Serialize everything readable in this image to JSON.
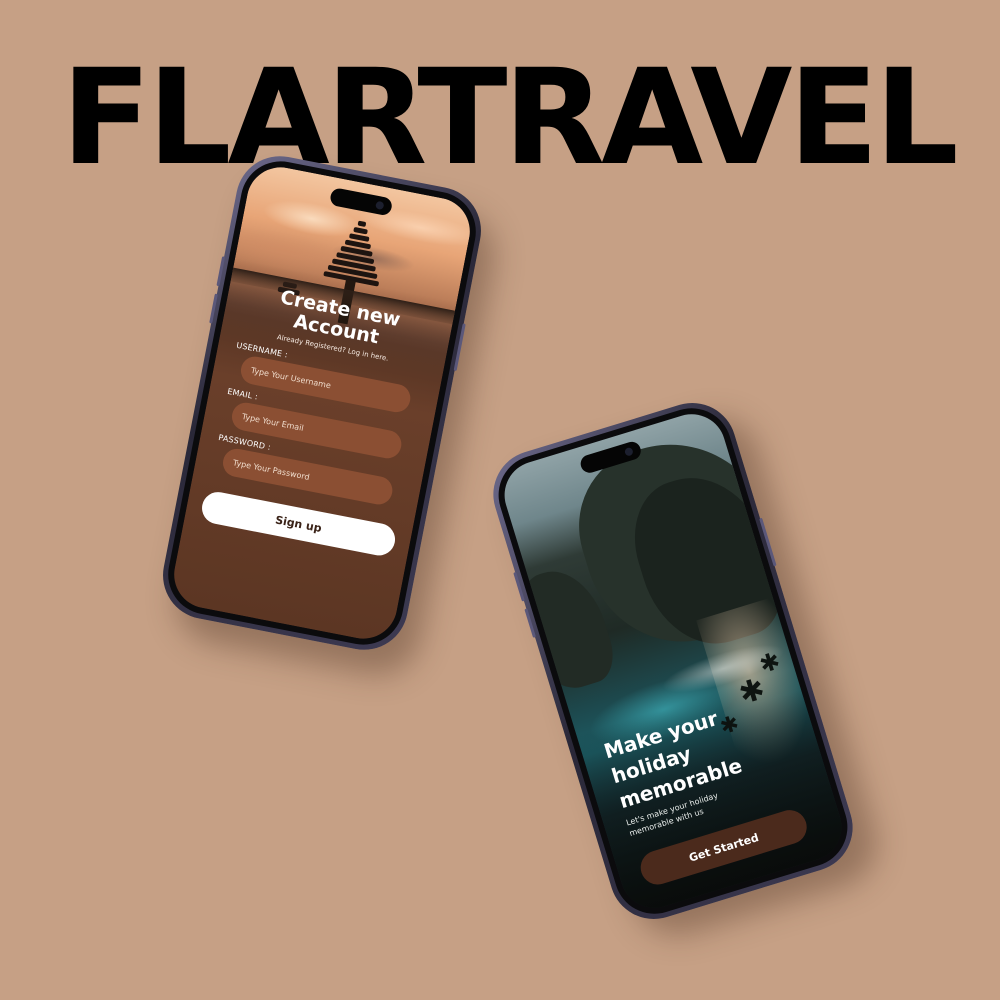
{
  "brand": {
    "title": "FLARTRAVEL"
  },
  "signup_screen": {
    "title": "Create new Account",
    "subtitle": "Already Registered? Log in here.",
    "username": {
      "label": "USERNAME :",
      "placeholder": "Type Your Username"
    },
    "email": {
      "label": "EMAIL :",
      "placeholder": "Type Your Email"
    },
    "password": {
      "label": "PASSWORD :",
      "placeholder": "Type Your Password"
    },
    "submit_label": "Sign up"
  },
  "onboarding_screen": {
    "headline": "Make your holiday memorable",
    "subtext": "Let's make your holiday memorable with us",
    "cta_label": "Get Started"
  },
  "colors": {
    "background": "#c6a085",
    "input_fill": "#8b4f33",
    "cta_fill": "#4b2a1c",
    "brand_text": "#000000"
  }
}
